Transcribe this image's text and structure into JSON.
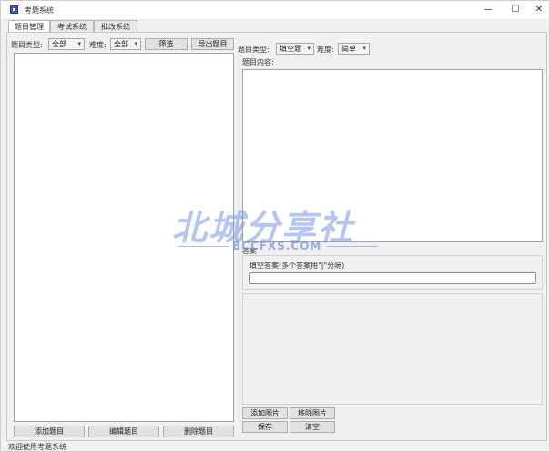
{
  "window": {
    "title": "考题系统",
    "minimize_glyph": "—",
    "maximize_glyph": "☐",
    "close_glyph": "✕"
  },
  "tabs": [
    {
      "label": "题目管理",
      "active": true
    },
    {
      "label": "考试系统",
      "active": false
    },
    {
      "label": "批改系统",
      "active": false
    }
  ],
  "left_panel": {
    "type_label": "题目类型:",
    "type_value": "全部",
    "difficulty_label": "难度:",
    "difficulty_value": "全部",
    "filter_button": "筛选",
    "export_button": "导出题目",
    "add_button": "添加题目",
    "edit_button": "编辑题目",
    "delete_button": "删除题目"
  },
  "right_panel": {
    "type_label": "题目类型:",
    "type_value": "填空题",
    "difficulty_label": "难度:",
    "difficulty_value": "简单",
    "content_label": "题目内容:",
    "answer_group_label": "答案",
    "fill_answer_label": "填空答案(多个答案用\"|\"分隔)",
    "fill_answer_value": "",
    "add_image_button": "添加图片",
    "remove_image_button": "移除图片",
    "save_button": "保存",
    "clear_button": "清空"
  },
  "status_bar": {
    "text": "欢迎使用考题系统"
  },
  "watermark": {
    "cn": "北城分享社",
    "en": "BCCFXS.COM"
  }
}
